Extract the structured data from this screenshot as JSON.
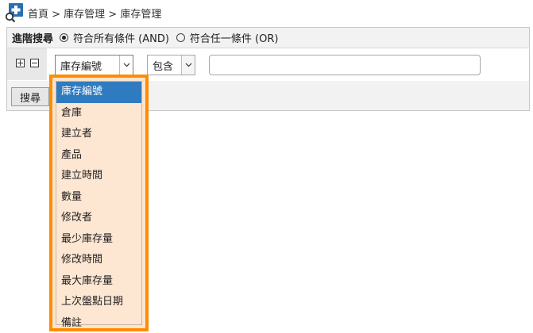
{
  "breadcrumb": {
    "icon": "document-search-icon",
    "text": "首頁 > 庫存管理 > 庫存管理"
  },
  "search_panel": {
    "header_label": "進階搜尋",
    "match_options": [
      {
        "label": "符合所有條件 (AND)",
        "checked": true
      },
      {
        "label": "符合任一條件 (OR)",
        "checked": false
      }
    ],
    "condition": {
      "field_value": "庫存編號",
      "operator_value": "包含",
      "text_value": ""
    },
    "search_button_label": "搜尋"
  },
  "field_dropdown": {
    "options": [
      {
        "label": "庫存編號",
        "selected": true
      },
      {
        "label": "倉庫",
        "selected": false
      },
      {
        "label": "建立者",
        "selected": false
      },
      {
        "label": "產品",
        "selected": false
      },
      {
        "label": "建立時間",
        "selected": false
      },
      {
        "label": "數量",
        "selected": false
      },
      {
        "label": "修改者",
        "selected": false
      },
      {
        "label": "最少庫存量",
        "selected": false
      },
      {
        "label": "修改時間",
        "selected": false
      },
      {
        "label": "最大庫存量",
        "selected": false
      },
      {
        "label": "上次盤點日期",
        "selected": false
      },
      {
        "label": "備註",
        "selected": false
      }
    ]
  },
  "colors": {
    "highlight_border": "#ff8c00",
    "selected_item": "#2f7bbf",
    "icon_blue": "#2a6fb0"
  }
}
